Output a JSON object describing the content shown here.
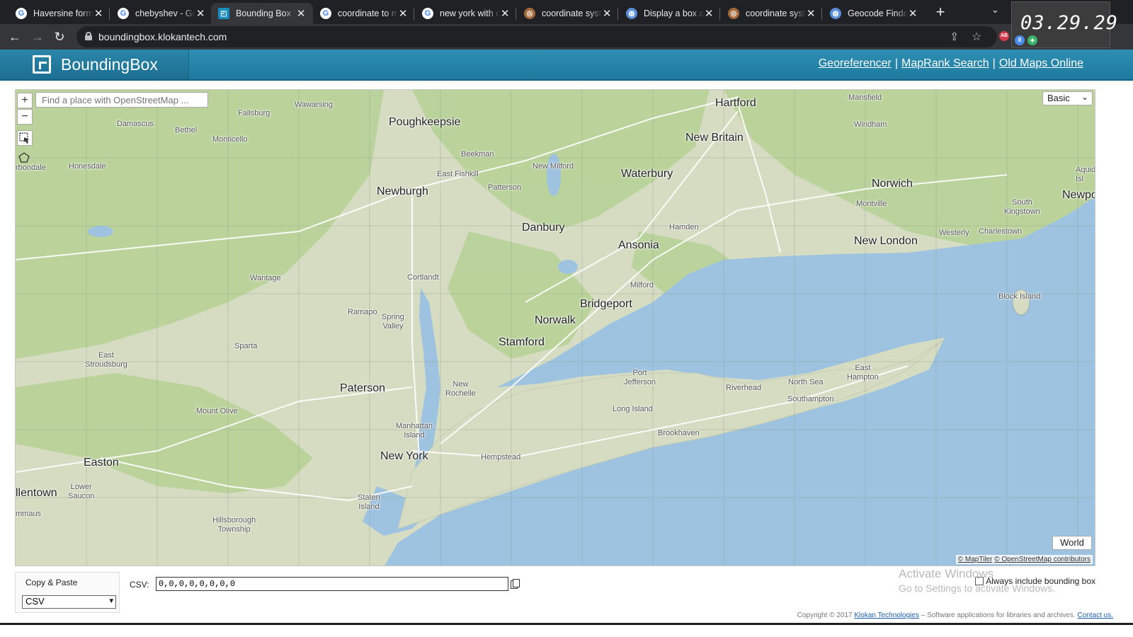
{
  "browser": {
    "tabs": [
      {
        "label": "Haversine formula",
        "icon": "google-icon"
      },
      {
        "label": "chebyshev - Google Search",
        "icon": "google-icon"
      },
      {
        "label": "Bounding Box Tool",
        "icon": "boundingbox-favicon"
      },
      {
        "label": "coordinate to meter",
        "icon": "google-icon"
      },
      {
        "label": "new york with coordinates",
        "icon": "google-icon"
      },
      {
        "label": "coordinate system",
        "icon": "stackoverflow-icon"
      },
      {
        "label": "Display a box and",
        "icon": "globe-icon"
      },
      {
        "label": "coordinate system",
        "icon": "stackoverflow-icon"
      },
      {
        "label": "Geocode Finder",
        "icon": "globe-icon"
      }
    ],
    "address": "boundingbox.klokantech.com",
    "clock": "03.29.29",
    "ext_badge": "AB"
  },
  "header": {
    "brand": "BoundingBox",
    "links": [
      {
        "label": "Georeferencer"
      },
      {
        "label": "MapRank Search"
      },
      {
        "label": "Old Maps Online"
      }
    ]
  },
  "map": {
    "search_placeholder": "Find a place with OpenStreetMap ...",
    "zoom_in": "+",
    "zoom_out": "−",
    "layer": "Basic",
    "world_button": "World",
    "attribution": [
      "© MapTiler",
      "© OpenStreetMap contributors"
    ],
    "labels": {
      "hartford": "Hartford",
      "new_britain": "New Britain",
      "waterbury": "Waterbury",
      "norwich": "Norwich",
      "new_london": "New London",
      "poughkeepsie": "Poughkeepsie",
      "newburgh": "Newburgh",
      "danbury": "Danbury",
      "ansonia": "Ansonia",
      "bridgeport": "Bridgeport",
      "norwalk": "Norwalk",
      "stamford": "Stamford",
      "paterson": "Paterson",
      "new_york": "New York",
      "easton": "Easton",
      "allentown": "llentown",
      "mansfield": "Mansfield",
      "windham": "Windham",
      "fallsburg": "Fallsburg",
      "wawarsing": "Wawarsing",
      "damascus": "Damascus",
      "bethel": "Bethel",
      "monticello": "Monticello",
      "honesdale": "Honesdale",
      "carbondale": "rbondale",
      "beekman": "Beekman",
      "east_fishkill": "East Fishkill",
      "new_milford": "New Milford",
      "patterson": "Patterson",
      "montville": "Montville",
      "south_kingstown": "South\nKingstown",
      "aquidneck": "Aquid\nIsl",
      "newport": "Newpo",
      "westerly": "Westerly",
      "charlestown": "Charlestown",
      "hamden": "Hamden",
      "milford": "Milford",
      "wantage": "Wantage",
      "cortlandt": "Cortlandt",
      "ramapo": "Ramapo",
      "spring_valley": "Spring\nValley",
      "sparta": "Sparta",
      "east_stroudsburg": "East\nStroudsburg",
      "mount_olive": "Mount Olive",
      "new_rochelle": "New\nRochelle",
      "port_jefferson": "Port\nJefferson",
      "riverhead": "Riverhead",
      "north_sea": "North Sea",
      "southampton": "Southampton",
      "east_hampton": "East\nHampton",
      "long_island": "Long Island",
      "brookhaven": "Brookhaven",
      "hempstead": "Hempstead",
      "manhattan_island": "Manhattan\nIsland",
      "block_island": "Block Island",
      "lower_saucon": "Lower\nSaucon",
      "emmaus": "mmaus",
      "staten_island": "Staten\nIsland",
      "hillsborough": "Hillsborough\nTownship"
    }
  },
  "panel": {
    "copy_paste": "Copy & Paste",
    "format": "CSV",
    "csv_label": "CSV:",
    "csv_value": "0,0,0,0,0,0,0,0",
    "always_include": "Always include bounding box"
  },
  "watermark": {
    "line1": "Activate Windows",
    "line2": "Go to Settings to activate Windows."
  },
  "footer": {
    "prefix": "Copyright © 2017",
    "company": "Klokan Technologies",
    "middle": " – Software applications for libraries and archives.",
    "contact": "Contact us."
  },
  "colors": {
    "header": "#1e7a9f",
    "water": "#9ec3e0",
    "land": "#d6dcc2",
    "forest": "#b8d197",
    "road": "#ffffff"
  }
}
